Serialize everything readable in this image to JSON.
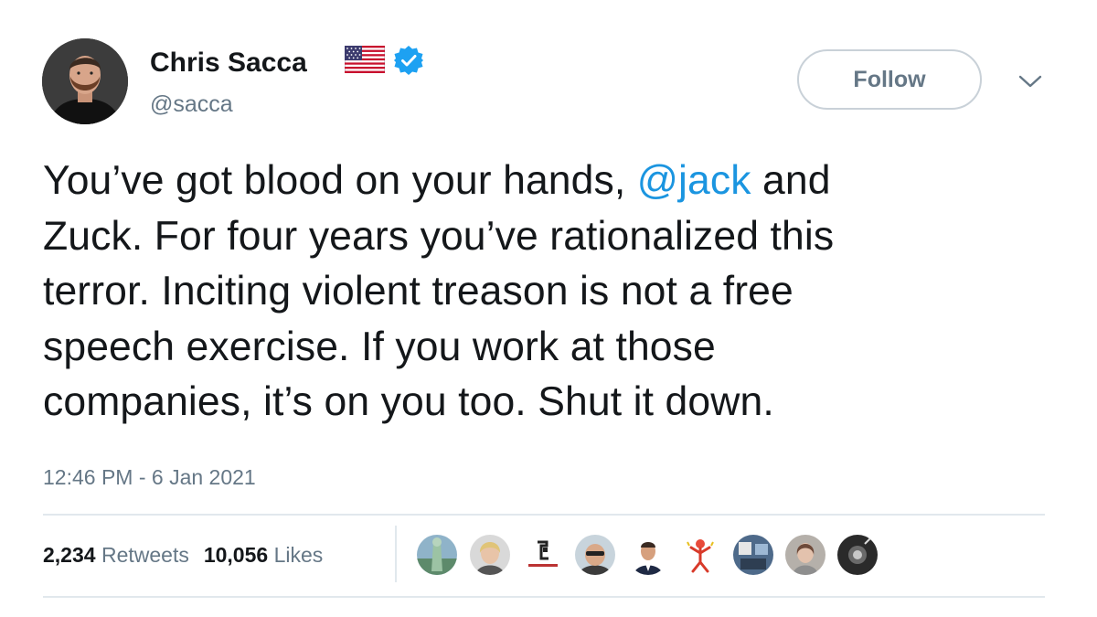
{
  "user": {
    "display_name": "Chris Sacca",
    "handle": "@sacca",
    "avatar_icon": "profile-photo",
    "flag_icon": "us-flag-icon",
    "verified_icon": "verified-badge-icon"
  },
  "actions": {
    "follow_label": "Follow",
    "menu_icon": "chevron-down-icon"
  },
  "tweet": {
    "lines": [
      {
        "before": "You’ve got blood on your hands, ",
        "mention": "@jack",
        "after": " and"
      },
      {
        "text": "Zuck. For four years you’ve rationalized this"
      },
      {
        "text": "terror. Inciting violent treason is not a free"
      },
      {
        "text": "speech exercise. If you work at those"
      },
      {
        "text": "companies, it’s on you too. Shut it down."
      }
    ],
    "timestamp": "12:46 PM - 6 Jan 2021"
  },
  "stats": {
    "retweets_count": "2,234",
    "retweets_label": "Retweets",
    "likes_count": "10,056",
    "likes_label": "Likes"
  },
  "likers": [
    {
      "name": "liker-avatar-1"
    },
    {
      "name": "liker-avatar-2"
    },
    {
      "name": "liker-avatar-3"
    },
    {
      "name": "liker-avatar-4"
    },
    {
      "name": "liker-avatar-5"
    },
    {
      "name": "liker-avatar-6"
    },
    {
      "name": "liker-avatar-7"
    },
    {
      "name": "liker-avatar-8"
    },
    {
      "name": "liker-avatar-9"
    }
  ],
  "colors": {
    "text": "#14171a",
    "secondary": "#657786",
    "link": "#1b95e0",
    "verified": "#1da1f2",
    "border": "#e1e8ed"
  }
}
